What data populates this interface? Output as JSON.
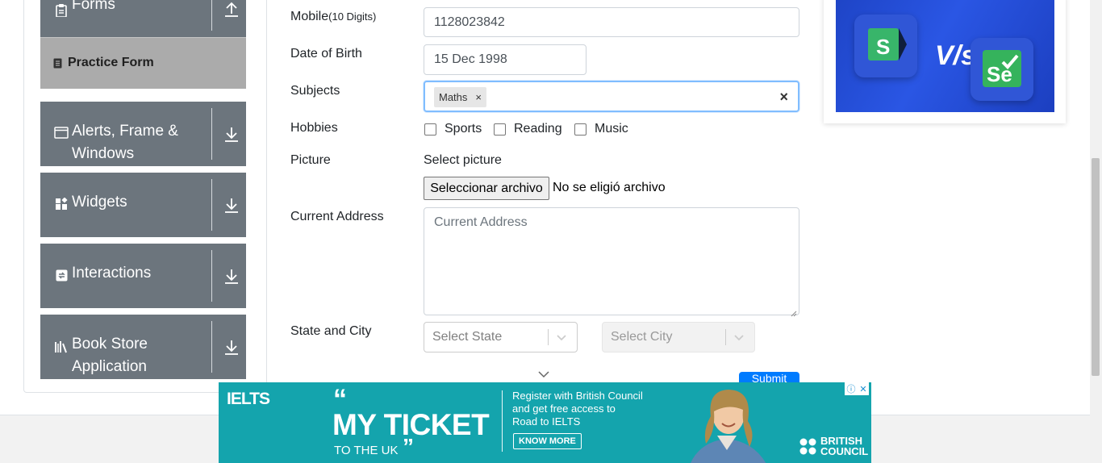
{
  "sidebar": {
    "groups": [
      {
        "label": "Forms",
        "icon": "clipboard-icon",
        "expanded": true
      },
      {
        "label": "Alerts, Frame & Windows",
        "icon": "window-icon",
        "expanded": false
      },
      {
        "label": "Widgets",
        "icon": "widgets-icon",
        "expanded": false
      },
      {
        "label": "Interactions",
        "icon": "interactions-icon",
        "expanded": false
      },
      {
        "label": "Book Store Application",
        "icon": "books-icon",
        "expanded": false
      }
    ],
    "active_item": {
      "label": "Practice Form",
      "icon": "form-icon"
    }
  },
  "form": {
    "mobile": {
      "label": "Mobile",
      "hint": "(10 Digits)",
      "value": "1128023842"
    },
    "dob": {
      "label": "Date of Birth",
      "value": "15 Dec 1998"
    },
    "subjects": {
      "label": "Subjects",
      "chips": [
        "Maths"
      ],
      "chip_remove": "×",
      "clear": "×"
    },
    "hobbies": {
      "label": "Hobbies",
      "options": [
        {
          "label": "Sports",
          "checked": false
        },
        {
          "label": "Reading",
          "checked": false
        },
        {
          "label": "Music",
          "checked": false
        }
      ]
    },
    "picture": {
      "label": "Picture",
      "prompt": "Select picture",
      "button": "Seleccionar archivo",
      "status": "No se eligió archivo"
    },
    "address": {
      "label": "Current Address",
      "placeholder": "Current Address"
    },
    "state_city": {
      "label": "State and City",
      "state_placeholder": "Select State",
      "city_placeholder": "Select City"
    },
    "submit": "Submit"
  },
  "ads": {
    "top_right": {
      "vs_text": "V/s"
    },
    "bottom_banner": {
      "brand": "IELTS",
      "quote_open": "“",
      "headline": "MY TICKET",
      "subline": "TO THE UK",
      "quote_close": "”",
      "text_line1": "Register with British Council",
      "text_line2": "and get free access to",
      "text_line3": "Road to IELTS",
      "cta": "KNOW MORE",
      "sponsor_line1": "BRITISH",
      "sponsor_line2": "COUNCIL",
      "info_icon": "ⓘ",
      "close_icon": "✕"
    }
  },
  "colors": {
    "sidebar_group": "#6c757d",
    "active_item": "#ababab",
    "focus_border": "#80bdff",
    "submit": "#007bff",
    "banner": "#14a4ad"
  }
}
